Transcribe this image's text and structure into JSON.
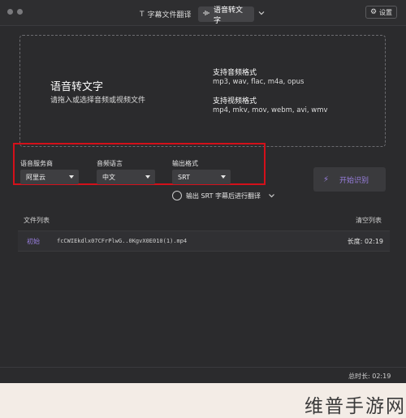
{
  "titlebar": {
    "tabs": [
      {
        "label": "字幕文件翻译",
        "icon": "text-icon"
      },
      {
        "label": "语音转文字",
        "icon": "waveform-icon",
        "active": true
      }
    ],
    "settings_label": "设置"
  },
  "dropzone": {
    "title": "语音转文字",
    "subtitle": "请拖入或选择音频或视频文件",
    "audio_formats_heading": "支持音频格式",
    "audio_formats": "mp3, wav, flac, m4a, opus",
    "video_formats_heading": "支持视频格式",
    "video_formats": "mp4, mkv, mov, webm, avi, wmv"
  },
  "options": {
    "provider": {
      "label": "语音服务商",
      "value": "阿里云"
    },
    "language": {
      "label": "音频语言",
      "value": "中文"
    },
    "format": {
      "label": "输出格式",
      "value": "SRT"
    }
  },
  "start_button": "开始识别",
  "translate_option": "输出 SRT 字幕后进行翻译",
  "file_list": {
    "title": "文件列表",
    "clear_label": "清空列表",
    "rows": [
      {
        "status": "初始",
        "name": "fcCWIEkdlx07CFrPlwG..0KgvX0E010(1).mp4",
        "duration": "长度: 02:19"
      }
    ]
  },
  "total_duration": "总时长: 02:19",
  "watermark": "维普手游网",
  "colors": {
    "accent": "#9a7fe0",
    "highlight": "#d4101a",
    "background": "#2b2b2d"
  }
}
